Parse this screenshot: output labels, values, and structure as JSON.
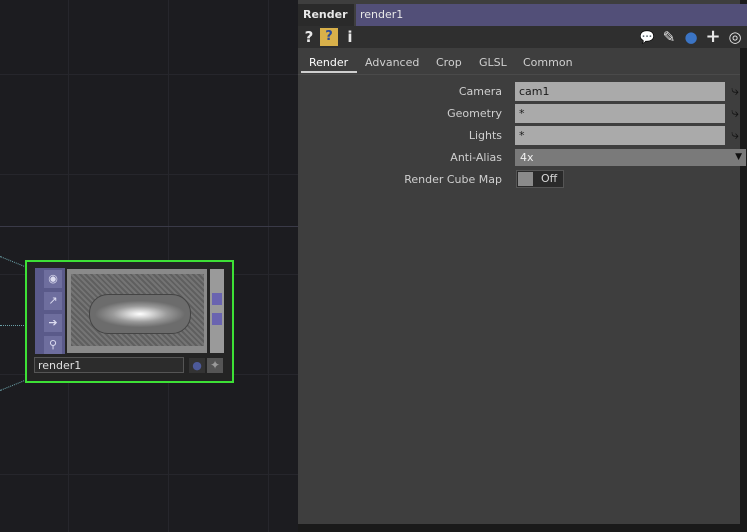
{
  "node": {
    "name": "render1",
    "side_icons": [
      "eye-icon",
      "chart-icon",
      "arrow-right-icon",
      "bomb-icon"
    ],
    "flag1": "●",
    "flag2": "✦"
  },
  "panel": {
    "op_type": "Render",
    "op_name": "render1",
    "toolbar": {
      "help": "?",
      "help_python": "?",
      "info": "i",
      "comment": "💬",
      "edit": "✎",
      "python": "●",
      "add": "+",
      "target": "◎"
    },
    "tabs": [
      "Render",
      "Advanced",
      "Crop",
      "GLSL",
      "Common"
    ],
    "active_tab": "Render",
    "params": {
      "camera": {
        "label": "Camera",
        "value": "cam1"
      },
      "geometry": {
        "label": "Geometry",
        "value": "*"
      },
      "lights": {
        "label": "Lights",
        "value": "*"
      },
      "anti_alias": {
        "label": "Anti-Alias",
        "value": "4x"
      },
      "render_cube_map": {
        "label": "Render Cube Map",
        "value": "Off"
      }
    }
  },
  "colors": {
    "node_selected": "#3de036",
    "title_accent": "#524f78",
    "field_bg": "#aaaaaa"
  }
}
